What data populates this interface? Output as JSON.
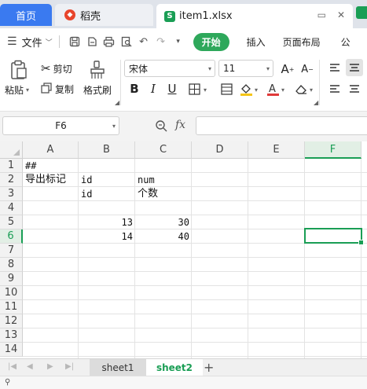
{
  "tabs": {
    "home": "首页",
    "daoke": "稻壳",
    "file": "item1.xlsx"
  },
  "menu": {
    "file": "文件",
    "start": "开始",
    "insert": "插入",
    "layout": "页面布局",
    "formula": "公"
  },
  "ribbon": {
    "paste": "粘贴",
    "cut": "剪切",
    "copy": "复制",
    "format_painter": "格式刷",
    "font_name": "宋体",
    "font_size": "11",
    "font_color": "#e03a3a",
    "fill_color": "#f5c518"
  },
  "formula_bar": {
    "cell_ref": "F6",
    "fx": "fx",
    "value": ""
  },
  "grid": {
    "columns": [
      "A",
      "B",
      "C",
      "D",
      "E",
      "F"
    ],
    "active_column": "F",
    "rows": [
      "1",
      "2",
      "3",
      "4",
      "5",
      "6",
      "7",
      "8",
      "9",
      "10",
      "11",
      "12",
      "13",
      "14"
    ],
    "active_row": "6",
    "cells": {
      "A1": "##",
      "A2": "导出标记",
      "B2": "id",
      "C2": "num",
      "B3": "id",
      "C3": "个数",
      "B5": "13",
      "C5": "30",
      "B6": "14",
      "C6": "40"
    }
  },
  "sheets": {
    "sheet1": "sheet1",
    "sheet2": "sheet2"
  },
  "colors": {
    "accent": "#1a9e55",
    "home_tab": "#3a7af0",
    "start_button": "#2ea85b"
  }
}
